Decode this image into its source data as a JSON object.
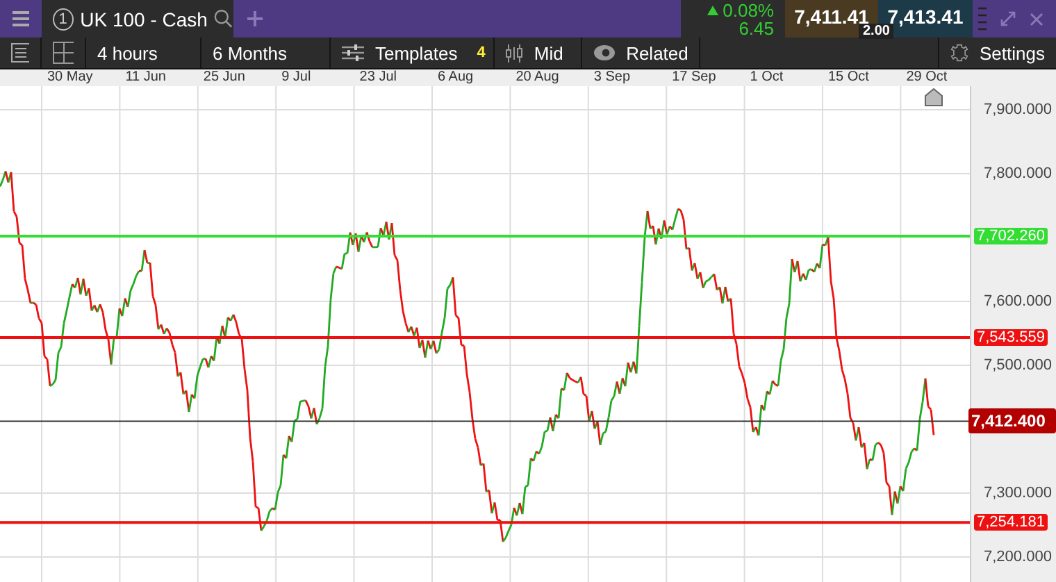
{
  "tab": {
    "number": "1",
    "title": "UK 100 - Cash"
  },
  "quote": {
    "change_percent": "0.08%",
    "change_points": "6.45",
    "sell": "7,411.41",
    "buy": "7,413.41",
    "spread": "2.00"
  },
  "toolbar": {
    "interval": "4 hours",
    "range": "6 Months",
    "templates": "Templates",
    "templates_count": "4",
    "price_type": "Mid",
    "related": "Related",
    "settings": "Settings"
  },
  "dates": [
    "30 May",
    "11 Jun",
    "25 Jun",
    "9 Jul",
    "23 Jul",
    "6 Aug",
    "20 Aug",
    "3 Sep",
    "17 Sep",
    "1 Oct",
    "15 Oct",
    "29 Oct"
  ],
  "y_axis": [
    "7,900.000",
    "7,800.000",
    "7,600.000",
    "7,500.000",
    "7,300.000",
    "7,200.000"
  ],
  "levels": [
    {
      "label": "7,702.260",
      "color": "#33dd33"
    },
    {
      "label": "7,543.559",
      "color": "#ee1111"
    },
    {
      "label": "7,254.181",
      "color": "#ee1111"
    }
  ],
  "current_price": "7,412.400"
}
